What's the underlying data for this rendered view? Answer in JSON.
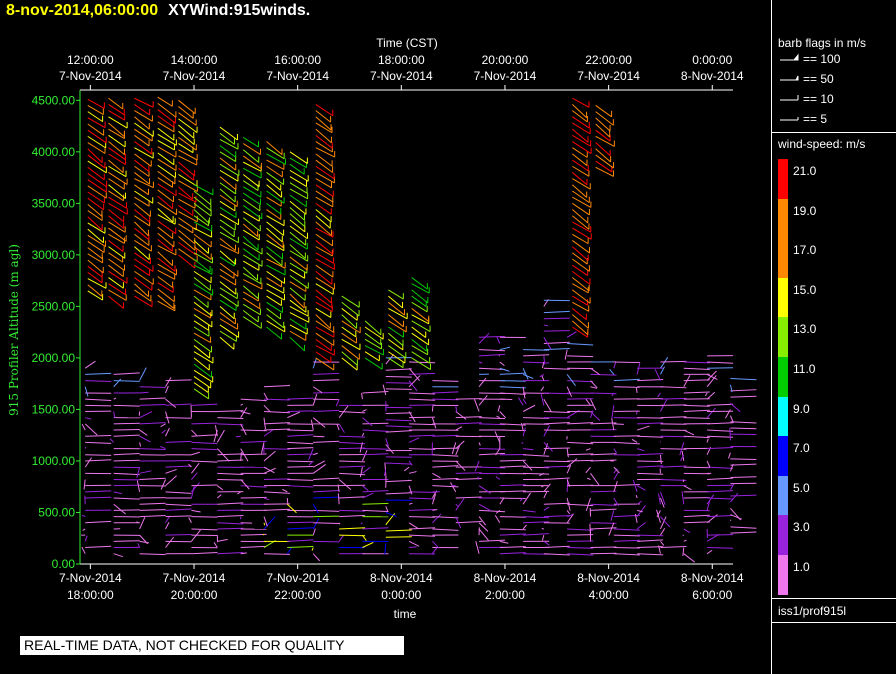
{
  "header": {
    "timestamp": "8-nov-2014,06:00:00",
    "product": "XYWind:915winds."
  },
  "chart_data": {
    "type": "wind-barb time-height",
    "top_axis_title": "Time (CST)",
    "bottom_axis_title": "time",
    "y_axis_title": "915 Profiler Altitude (m agl)",
    "ylim": [
      0,
      4600
    ],
    "y_ticks": [
      "0.00",
      "500.00",
      "1000.00",
      "1500.00",
      "2000.00",
      "2500.00",
      "3000.00",
      "3500.00",
      "4000.00",
      "4500.00"
    ],
    "x_range_utc_hours": [
      17.8,
      30.4
    ],
    "top_ticks": [
      {
        "time": "12:00:00",
        "date": "7-Nov-2014"
      },
      {
        "time": "14:00:00",
        "date": "7-Nov-2014"
      },
      {
        "time": "16:00:00",
        "date": "7-Nov-2014"
      },
      {
        "time": "18:00:00",
        "date": "7-Nov-2014"
      },
      {
        "time": "20:00:00",
        "date": "7-Nov-2014"
      },
      {
        "time": "22:00:00",
        "date": "7-Nov-2014"
      },
      {
        "time": "0:00:00",
        "date": "8-Nov-2014"
      }
    ],
    "bottom_ticks": [
      {
        "date": "7-Nov-2014",
        "time": "18:00:00"
      },
      {
        "date": "7-Nov-2014",
        "time": "20:00:00"
      },
      {
        "date": "7-Nov-2014",
        "time": "22:00:00"
      },
      {
        "date": "8-Nov-2014",
        "time": "0:00:00"
      },
      {
        "date": "8-Nov-2014",
        "time": "2:00:00"
      },
      {
        "date": "8-Nov-2014",
        "time": "4:00:00"
      },
      {
        "date": "8-Nov-2014",
        "time": "6:00:00"
      }
    ],
    "profiles": [
      {
        "t": 17.9,
        "lo": 100,
        "hi": 1900,
        "mode": "low"
      },
      {
        "t": 17.95,
        "lo": 2650,
        "hi": 4550,
        "mode": "upper"
      },
      {
        "t": 18.35,
        "lo": 2600,
        "hi": 4550,
        "mode": "upper"
      },
      {
        "t": 18.45,
        "lo": 100,
        "hi": 1850,
        "mode": "low"
      },
      {
        "t": 18.85,
        "lo": 2600,
        "hi": 4550,
        "mode": "upper"
      },
      {
        "t": 18.95,
        "lo": 100,
        "hi": 1800,
        "mode": "low"
      },
      {
        "t": 19.3,
        "lo": 2550,
        "hi": 4550,
        "mode": "upper"
      },
      {
        "t": 19.45,
        "lo": 100,
        "hi": 1800,
        "mode": "low"
      },
      {
        "t": 19.7,
        "lo": 3000,
        "hi": 4550,
        "mode": "upper"
      },
      {
        "t": 19.95,
        "lo": 100,
        "hi": 1550,
        "mode": "low"
      },
      {
        "t": 20.0,
        "lo": 1700,
        "hi": 3700,
        "mode": "mid"
      },
      {
        "t": 20.45,
        "lo": 100,
        "hi": 1500,
        "mode": "low"
      },
      {
        "t": 20.5,
        "lo": 2200,
        "hi": 4250,
        "mode": "mid"
      },
      {
        "t": 20.9,
        "lo": 100,
        "hi": 1600,
        "mode": "low"
      },
      {
        "t": 20.95,
        "lo": 2400,
        "hi": 4150,
        "mode": "mid"
      },
      {
        "t": 21.35,
        "lo": 100,
        "hi": 1750,
        "mode": "low"
      },
      {
        "t": 21.4,
        "lo": 2300,
        "hi": 4150,
        "mode": "mid"
      },
      {
        "t": 21.8,
        "lo": 100,
        "hi": 1600,
        "mode": "low"
      },
      {
        "t": 21.85,
        "lo": 2200,
        "hi": 4050,
        "mode": "mid"
      },
      {
        "t": 22.3,
        "lo": 100,
        "hi": 2000,
        "mode": "low"
      },
      {
        "t": 22.35,
        "lo": 2000,
        "hi": 4500,
        "mode": "upper"
      },
      {
        "t": 22.8,
        "lo": 100,
        "hi": 1600,
        "mode": "low"
      },
      {
        "t": 22.85,
        "lo": 2000,
        "hi": 2600,
        "mode": "mid"
      },
      {
        "t": 23.25,
        "lo": 100,
        "hi": 1700,
        "mode": "low"
      },
      {
        "t": 23.3,
        "lo": 2000,
        "hi": 2400,
        "mode": "mid"
      },
      {
        "t": 23.7,
        "lo": 200,
        "hi": 2000,
        "mode": "low"
      },
      {
        "t": 23.75,
        "lo": 2000,
        "hi": 2700,
        "mode": "mid"
      },
      {
        "t": 24.15,
        "lo": 100,
        "hi": 2000,
        "mode": "low"
      },
      {
        "t": 24.2,
        "lo": 2000,
        "hi": 2800,
        "mode": "mid"
      },
      {
        "t": 24.6,
        "lo": 100,
        "hi": 1800,
        "mode": "low"
      },
      {
        "t": 25.05,
        "lo": 400,
        "hi": 1600,
        "mode": "low"
      },
      {
        "t": 25.5,
        "lo": 100,
        "hi": 2200,
        "mode": "low"
      },
      {
        "t": 25.9,
        "lo": 100,
        "hi": 2200,
        "mode": "low"
      },
      {
        "t": 26.35,
        "lo": 100,
        "hi": 2100,
        "mode": "low"
      },
      {
        "t": 26.75,
        "lo": 100,
        "hi": 2600,
        "mode": "low"
      },
      {
        "t": 27.2,
        "lo": 100,
        "hi": 2200,
        "mode": "low"
      },
      {
        "t": 27.3,
        "lo": 2300,
        "hi": 4550,
        "mode": "jet"
      },
      {
        "t": 27.65,
        "lo": 100,
        "hi": 2000,
        "mode": "low"
      },
      {
        "t": 27.75,
        "lo": 3850,
        "hi": 4450,
        "mode": "jet"
      },
      {
        "t": 28.1,
        "lo": 100,
        "hi": 2000,
        "mode": "low"
      },
      {
        "t": 28.55,
        "lo": 100,
        "hi": 1900,
        "mode": "low"
      },
      {
        "t": 29.0,
        "lo": 100,
        "hi": 2000,
        "mode": "low"
      },
      {
        "t": 29.45,
        "lo": 100,
        "hi": 2000,
        "mode": "low"
      },
      {
        "t": 29.9,
        "lo": 100,
        "hi": 2050,
        "mode": "low"
      },
      {
        "t": 30.35,
        "lo": 300,
        "hi": 1800,
        "mode": "low"
      }
    ]
  },
  "legend": {
    "barb_title": "barb flags in m/s",
    "barb_items": [
      "== 100",
      "== 50",
      "== 10",
      "== 5"
    ],
    "speed_title": "wind-speed: m/s",
    "speed_labels": [
      "21.0",
      "19.0",
      "17.0",
      "15.0",
      "13.0",
      "11.0",
      "9.0",
      "7.0",
      "5.0",
      "3.0",
      "1.0"
    ],
    "speed_colors": [
      "#ff0000",
      "#ff8800",
      "#ff8800",
      "#ffff00",
      "#88ee00",
      "#00cc00",
      "#00ffff",
      "#0000ff",
      "#6699ff",
      "#9922dd",
      "#ee77ee"
    ],
    "source": "iss1/prof915l"
  },
  "banner": "REAL-TIME DATA, NOT CHECKED FOR QUALITY"
}
